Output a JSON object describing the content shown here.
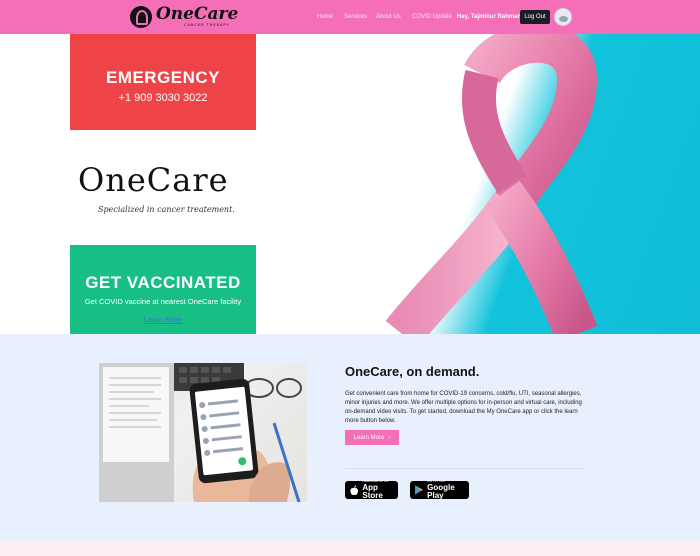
{
  "navbar": {
    "logo_name": "OneCare",
    "logo_sub": "CANCER THERAPY",
    "links": [
      "Home",
      "Services",
      "About Us",
      "COVID Update"
    ],
    "greeting": "Hey, Tajminur Rahman",
    "logout_label": "Log Out",
    "accent_color": "#f46fb8"
  },
  "hero": {
    "emergency_title": "EMERGENCY",
    "emergency_phone": "+1 909 3030 3022",
    "brand": "OneCare",
    "tagline": "Specialized in cancer treatement.",
    "vaccinated_title": "GET VACCINATED",
    "vaccinated_sub": "Get COVID vaccine at nearest OneCare facility",
    "vaccinated_link": "Learn More",
    "emergency_color": "#ee4447",
    "vaccinated_color": "#17bf85",
    "image_icon": "pink-ribbon-image"
  },
  "ondemand": {
    "title": "OneCare, on demand.",
    "body": "Get convenient care from home for COVID-19 concerns, cold/flu, UTI, seasonal allergies, minor injuries and more. We offer multiple options for in-person and virtual care, including on-demand video visits. To get started, download the My OneCare app or click the learn more button below.",
    "button_label": "Learn More",
    "app_store": {
      "small": "Download on the",
      "big": "App Store"
    },
    "google_play": {
      "small": "GET IT ON",
      "big": "Google Play"
    },
    "photo_icon": "phone-app-photo"
  }
}
